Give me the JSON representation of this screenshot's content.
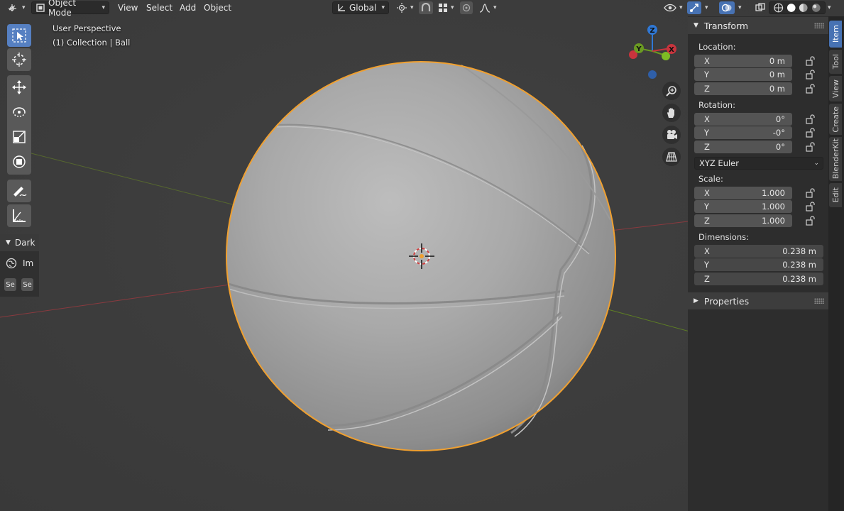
{
  "header": {
    "editor_type_icon": "orbit-editor-icon",
    "mode": "Object Mode",
    "menus": [
      "View",
      "Select",
      "Add",
      "Object"
    ],
    "transform_orientation": "Global"
  },
  "viewport": {
    "perspective_label": "User Perspective",
    "collection_label": "(1) Collection | Ball"
  },
  "gizmo": {
    "x": "X",
    "y": "Y",
    "z": "Z"
  },
  "left_panel": {
    "title": "Dark",
    "item_label": "Im",
    "btn1": "Se",
    "btn2": "Se"
  },
  "sidebar": {
    "transform_title": "Transform",
    "location_label": "Location:",
    "location": [
      {
        "axis": "X",
        "value": "0 m"
      },
      {
        "axis": "Y",
        "value": "0 m"
      },
      {
        "axis": "Z",
        "value": "0 m"
      }
    ],
    "rotation_label": "Rotation:",
    "rotation": [
      {
        "axis": "X",
        "value": "0°"
      },
      {
        "axis": "Y",
        "value": "-0°"
      },
      {
        "axis": "Z",
        "value": "0°"
      }
    ],
    "rotation_mode": "XYZ Euler",
    "scale_label": "Scale:",
    "scale": [
      {
        "axis": "X",
        "value": "1.000"
      },
      {
        "axis": "Y",
        "value": "1.000"
      },
      {
        "axis": "Z",
        "value": "1.000"
      }
    ],
    "dimensions_label": "Dimensions:",
    "dimensions": [
      {
        "axis": "X",
        "value": "0.238 m"
      },
      {
        "axis": "Y",
        "value": "0.238 m"
      },
      {
        "axis": "Z",
        "value": "0.238 m"
      }
    ],
    "properties_title": "Properties"
  },
  "tabs": [
    "Item",
    "Tool",
    "View",
    "Create",
    "BlenderKit",
    "Edit"
  ],
  "colors": {
    "accent": "#4772b3",
    "selection_outline": "#f0a030",
    "axis_x": "#c8343d",
    "axis_y": "#6a9a22",
    "axis_z": "#2f78d6"
  }
}
